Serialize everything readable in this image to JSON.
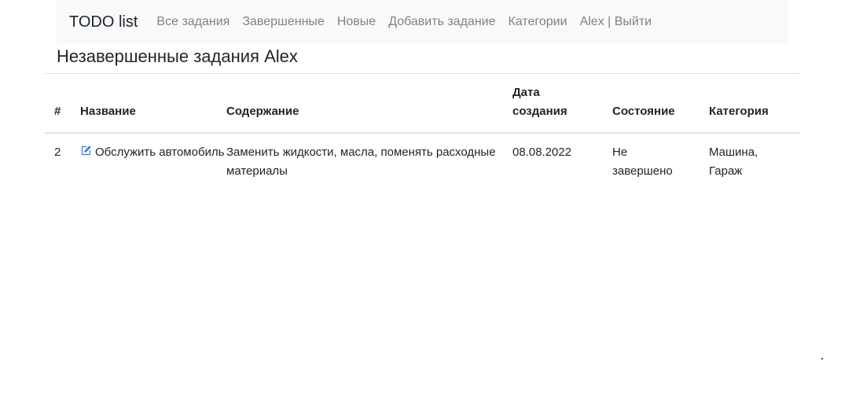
{
  "navbar": {
    "brand": "TODO list",
    "links": [
      {
        "label": "Все задания"
      },
      {
        "label": "Завершенные"
      },
      {
        "label": "Новые"
      },
      {
        "label": "Добавить задание"
      },
      {
        "label": "Категории"
      },
      {
        "label": "Alex | Выйти"
      }
    ]
  },
  "page": {
    "title": "Незавершенные задания Alex"
  },
  "table": {
    "headers": {
      "num": "#",
      "name": "Название",
      "content": "Содержание",
      "date": "Дата создания",
      "state": "Состояние",
      "category": "Категория"
    },
    "rows": [
      {
        "num": "2",
        "name": "Обслужить автомобиль",
        "content": "Заменить жидкости, масла, поменять расходные материалы",
        "date": "08.08.2022",
        "state": "Не завершено",
        "category": "Машина, Гараж"
      }
    ]
  },
  "colors": {
    "navbar_bg": "#f8f9fa",
    "nav_link": "#808284",
    "icon_blue": "#0d6efd"
  },
  "icons": {
    "edit": "edit-icon"
  }
}
